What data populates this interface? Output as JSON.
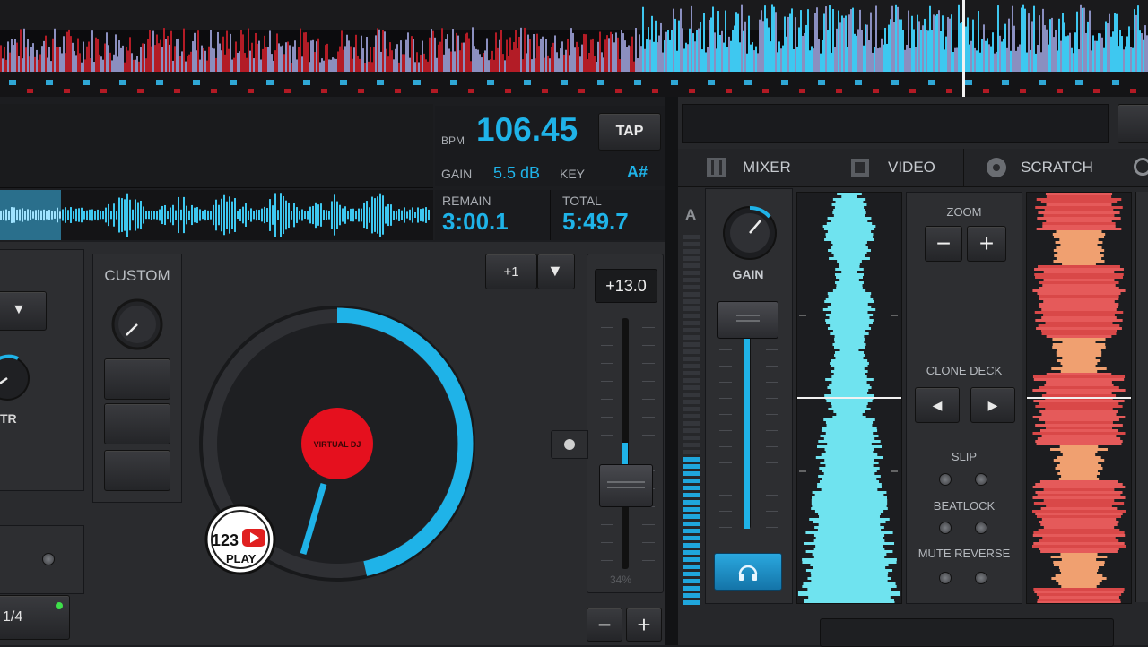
{
  "deck": {
    "bpm_label": "BPM",
    "bpm_value": "106.45",
    "tap_label": "TAP",
    "gain_label": "GAIN",
    "gain_value": "5.5 dB",
    "key_label": "KEY",
    "key_value": "A#",
    "remain_label": "REMAIN",
    "remain_value": "3:00.1",
    "total_label": "TOTAL",
    "total_value": "5:49.7",
    "custom_label": "CUSTOM",
    "pitch_step": "+1",
    "pitch_value": "+13.0",
    "pitch_percent": "34%",
    "beat_fraction": "1/4",
    "filter_label": "TR",
    "platter_label": "VIRTUAL DJ"
  },
  "tabs": [
    {
      "label": "MIXER",
      "icon": "mixer-icon"
    },
    {
      "label": "VIDEO",
      "icon": "film-icon"
    },
    {
      "label": "SCRATCH",
      "icon": "vinyl-icon"
    }
  ],
  "mixer": {
    "channel": "A",
    "gain_label": "GAIN",
    "zoom_label": "ZOOM",
    "clone_label": "CLONE DECK",
    "slip_label": "SLIP",
    "beatlock_label": "BEATLOCK",
    "mute_reverse_label": "MUTE REVERSE"
  },
  "watermark": {
    "text_top": "123",
    "text_bottom": "PLAY"
  },
  "colors": {
    "accent": "#1fb3e8",
    "waveform_red": "#c8202a",
    "waveform_blue": "#3ec8f0",
    "platter_label": "#e5101e"
  }
}
